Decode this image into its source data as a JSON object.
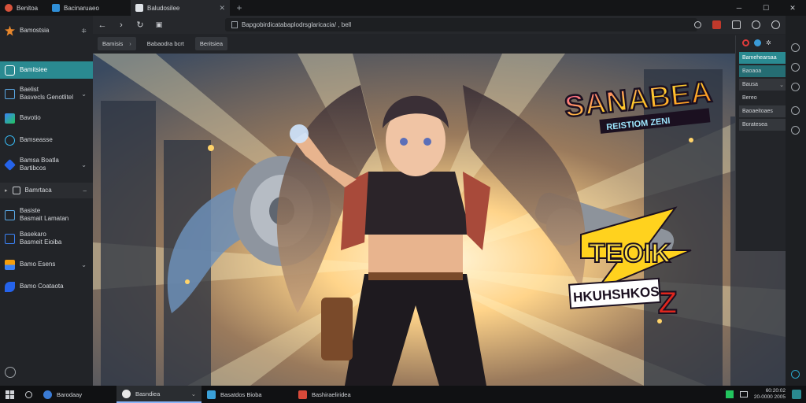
{
  "tabs": [
    {
      "label": "Benitoa",
      "color": "#d8533c"
    },
    {
      "label": "Bacinaruaeo",
      "color": "#2f8fd8"
    },
    {
      "label": "Baludosilee",
      "color": "#dfe3e8"
    }
  ],
  "toolbar": {
    "url": "Bapgobirdicatabaplodrsglaricacia/ , bell",
    "bookmarks": [
      "Bamisis",
      "Babaodra bcrt",
      "Beritsiea"
    ]
  },
  "sidebar": {
    "header": "Bamostsia",
    "items": [
      {
        "label": "Bamitsiee",
        "icon": "compass-icon"
      },
      {
        "label": "Baelist\nBasvecls Genotlitel",
        "icon": "monitor-icon"
      },
      {
        "label": "Bavotio",
        "icon": "share-icon"
      },
      {
        "label": "Bamseasse",
        "icon": "refresh-icon"
      },
      {
        "label": "Bamsa Boatla\nBartibcos",
        "icon": "cube-icon"
      },
      {
        "label": "Bamrtaca",
        "icon": "folder-icon"
      },
      {
        "label": "Basiste\nBasmait Lamatan",
        "icon": "document-icon"
      },
      {
        "label": "Basekaro\nBasmeit Eioiba",
        "icon": "save-icon"
      },
      {
        "label": "Bamo Esens",
        "icon": "image-icon"
      },
      {
        "label": "Bamo Coataota",
        "icon": "layers-icon"
      }
    ]
  },
  "artwork": {
    "logo_top": "SANABEA",
    "logo_top_sub": "REISTIOM ZENI",
    "logo_bottom_1": "TEOIK",
    "logo_bottom_2": "HKUHSHKOS",
    "logo_bottom_3": "Z"
  },
  "panel": {
    "items": [
      "Bamehearsaa",
      "Baoaoa",
      "Bausa",
      "Bereo",
      "Baoaeitoaes",
      "Boratesea"
    ]
  },
  "taskbar": {
    "items": [
      {
        "label": "Barodaay",
        "color": "#3a7bd5"
      },
      {
        "label": "Basndiea",
        "color": "#e8e8e8"
      },
      {
        "label": "Basatdos Bioba",
        "color": "#3aa0d8"
      },
      {
        "label": "Bashiraeliridea",
        "color": "#d84a3a"
      }
    ],
    "time": "60:20:02",
    "date": "20-0000 2005"
  },
  "colors": {
    "accent": "#2a8a91",
    "chrome": "#222428"
  }
}
